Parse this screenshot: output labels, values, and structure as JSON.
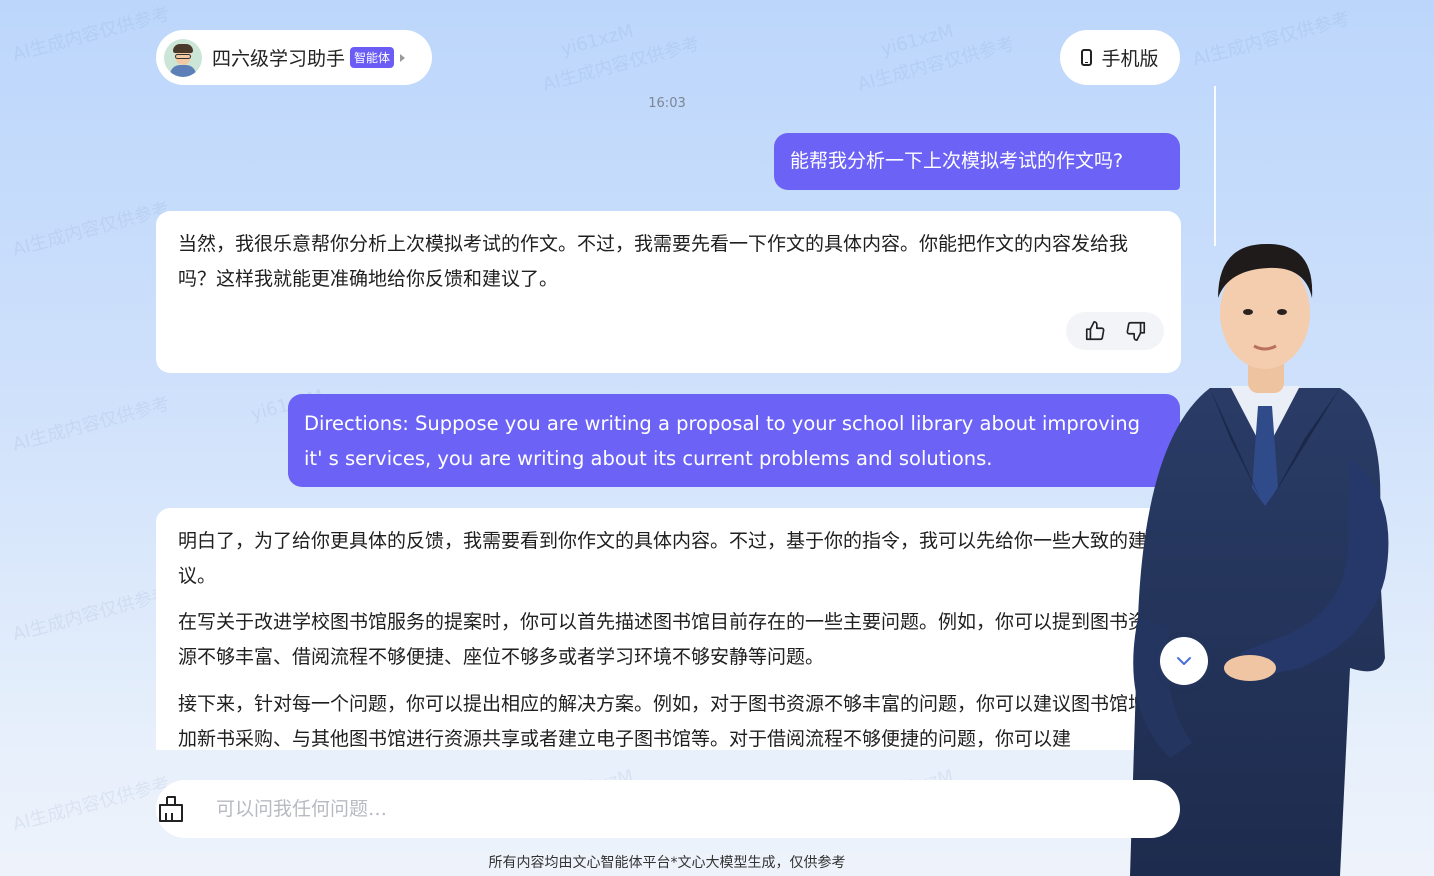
{
  "agent": {
    "name": "四六级学习助手",
    "badge": "智能体"
  },
  "header": {
    "mobile_label": "手机版"
  },
  "chat": {
    "timestamp": "16:03",
    "messages": [
      {
        "role": "user",
        "text": "能帮我分析一下上次模拟考试的作文吗?"
      },
      {
        "role": "assistant",
        "paragraphs": [
          "当然，我很乐意帮你分析上次模拟考试的作文。不过，我需要先看一下作文的具体内容。你能把作文的内容发给我吗？这样我就能更准确地给你反馈和建议了。"
        ]
      },
      {
        "role": "user",
        "text": "Directions: Suppose you are writing a proposal to your school library about improving it' s services, you are writing about its current problems and solutions."
      },
      {
        "role": "assistant",
        "paragraphs": [
          "明白了，为了给你更具体的反馈，我需要看到你作文的具体内容。不过，基于你的指令，我可以先给你一些大致的建议。",
          "在写关于改进学校图书馆服务的提案时，你可以首先描述图书馆目前存在的一些主要问题。例如，你可以提到图书资源不够丰富、借阅流程不够便捷、座位不够多或者学习环境不够安静等问题。",
          "接下来，针对每一个问题，你可以提出相应的解决方案。例如，对于图书资源不够丰富的问题，你可以建议图书馆增加新书采购、与其他图书馆进行资源共享或者建立电子图书馆等。对于借阅流程不够便捷的问题，你可以建"
        ]
      }
    ]
  },
  "input": {
    "placeholder": "可以问我任何问题…"
  },
  "footer": {
    "note": "所有内容均由文心智能体平台*文心大模型生成，仅供参考"
  },
  "watermark": {
    "text_1": "yi61xzM",
    "text_2": "AI生成内容仅供参考"
  },
  "colors": {
    "accent": "#6c63f6",
    "badge": "#6a5cf5",
    "bubble_bot": "#ffffff"
  },
  "icons": {
    "like": "thumbs-up-icon",
    "dislike": "thumbs-down-icon",
    "scroll": "chevron-down-icon",
    "clear": "broom-icon",
    "phone": "phone-icon"
  }
}
